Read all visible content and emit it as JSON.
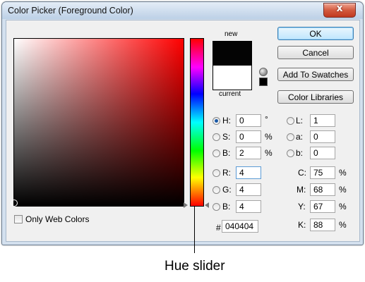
{
  "window": {
    "title": "Color Picker (Foreground Color)",
    "close_symbol": "x"
  },
  "swatch": {
    "new_label": "new",
    "current_label": "current",
    "new_color": "#040404",
    "current_color": "#ffffff"
  },
  "buttons": {
    "ok": "OK",
    "cancel": "Cancel",
    "add_to_swatches": "Add To Swatches",
    "color_libraries": "Color Libraries"
  },
  "fields": {
    "H": {
      "label": "H:",
      "value": "0",
      "unit": "°",
      "selected": true
    },
    "S": {
      "label": "S:",
      "value": "0",
      "unit": "%"
    },
    "Bv": {
      "label": "B:",
      "value": "2",
      "unit": "%"
    },
    "R": {
      "label": "R:",
      "value": "4"
    },
    "G": {
      "label": "G:",
      "value": "4"
    },
    "Bc": {
      "label": "B:",
      "value": "4"
    },
    "L": {
      "label": "L:",
      "value": "1"
    },
    "a": {
      "label": "a:",
      "value": "0"
    },
    "b": {
      "label": "b:",
      "value": "0"
    },
    "C": {
      "label": "C:",
      "value": "75",
      "unit": "%"
    },
    "M": {
      "label": "M:",
      "value": "68",
      "unit": "%"
    },
    "Y": {
      "label": "Y:",
      "value": "67",
      "unit": "%"
    },
    "K": {
      "label": "K:",
      "value": "88",
      "unit": "%"
    },
    "hex": {
      "label": "#",
      "value": "040404"
    }
  },
  "only_web_colors": {
    "label": "Only Web Colors",
    "checked": false
  },
  "annotation": {
    "caption": "Hue slider"
  },
  "colors": {
    "field_hue": "#ff0000",
    "titlebar": "#bcd0e6",
    "dialog_bg": "#f0f0f0"
  },
  "icons": [
    "close-icon",
    "gamut-warning-icon",
    "slider-arrow-icon"
  ]
}
